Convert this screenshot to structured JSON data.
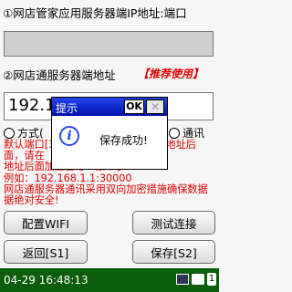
{
  "section1": {
    "label": "①网店管家应用服务器端IP地址:端口",
    "value": ""
  },
  "section2": {
    "label": "②网店通服务器端地址",
    "badge": "【推荐使用】",
    "value": "192.168.1.1"
  },
  "radios": [
    {
      "label": "方式("
    },
    {
      "label": "通讯"
    }
  ],
  "note": "默认端口[30000]，若更改过，在IP地址后面，请在地址后面加上冒号: 端口号",
  "note_lines": [
    "默认端口[30000]，若更改过，在IP地址后面，请在",
    "地址后面加上冒号: 端口号",
    "例如：192.168.1.1:30000",
    "网店通服务器通讯采用双向加密措施确保数据",
    "据绝对安全!"
  ],
  "buttons": {
    "wifi": "配置WIFI",
    "test": "测试连接",
    "back": "返回[S1]",
    "save": "保存[S2]"
  },
  "taskbar": {
    "datetime": "04-29 16:48:13"
  },
  "dialog": {
    "title": "提示",
    "ok": "OK",
    "close": "✕",
    "message": "保存成功!",
    "icon": "info-icon"
  }
}
